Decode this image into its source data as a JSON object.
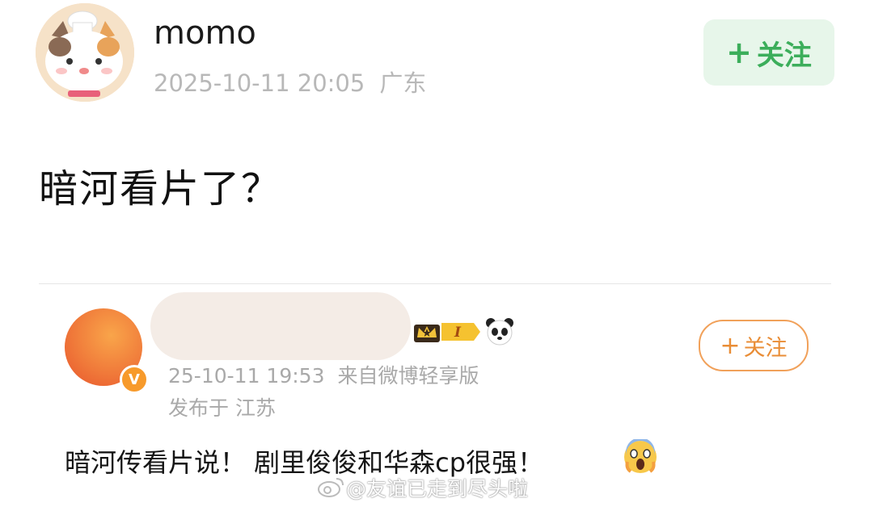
{
  "post1": {
    "username": "momo",
    "timestamp": "2025-10-11 20:05",
    "location": "广东",
    "follow_label": "关注",
    "follow_plus": "+",
    "text": "暗河看片了？"
  },
  "post2": {
    "level_badge": "I",
    "verified_mark": "V",
    "timestamp": "25-10-11 19:53",
    "source": "来自微博轻享版",
    "location": "发布于 江苏",
    "follow_label": "关注",
    "follow_plus": "+",
    "text": "暗河传看片说！ 剧里俊俊和华森cp很强！",
    "emoji": "scream-emoji"
  },
  "watermark": {
    "text": "@友谊已走到尽头啦"
  },
  "colors": {
    "follow_green_bg": "#e7f6ea",
    "follow_green_text": "#3cae5b",
    "follow_orange": "#e98d36",
    "meta_gray": "#b8b8b8",
    "avatar_orange": "#f07a3a"
  }
}
